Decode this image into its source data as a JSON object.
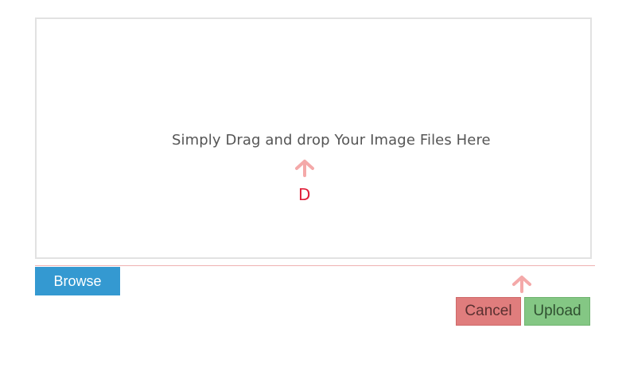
{
  "dropzone": {
    "instruction": "Simply Drag and drop Your Image Files Here",
    "marker_label": "D"
  },
  "actions": {
    "browse_label": "Browse",
    "cancel_label": "Cancel",
    "upload_label": "Upload"
  },
  "icons": {
    "dropzone_arrow": "arrow-up-icon",
    "buttons_arrow": "arrow-up-icon"
  },
  "colors": {
    "browse": "#3499d1",
    "cancel": "#e07d7d",
    "upload": "#84c784",
    "arrow": "#f4a9a9",
    "marker": "#e0203a",
    "divider": "#efb1b1"
  }
}
